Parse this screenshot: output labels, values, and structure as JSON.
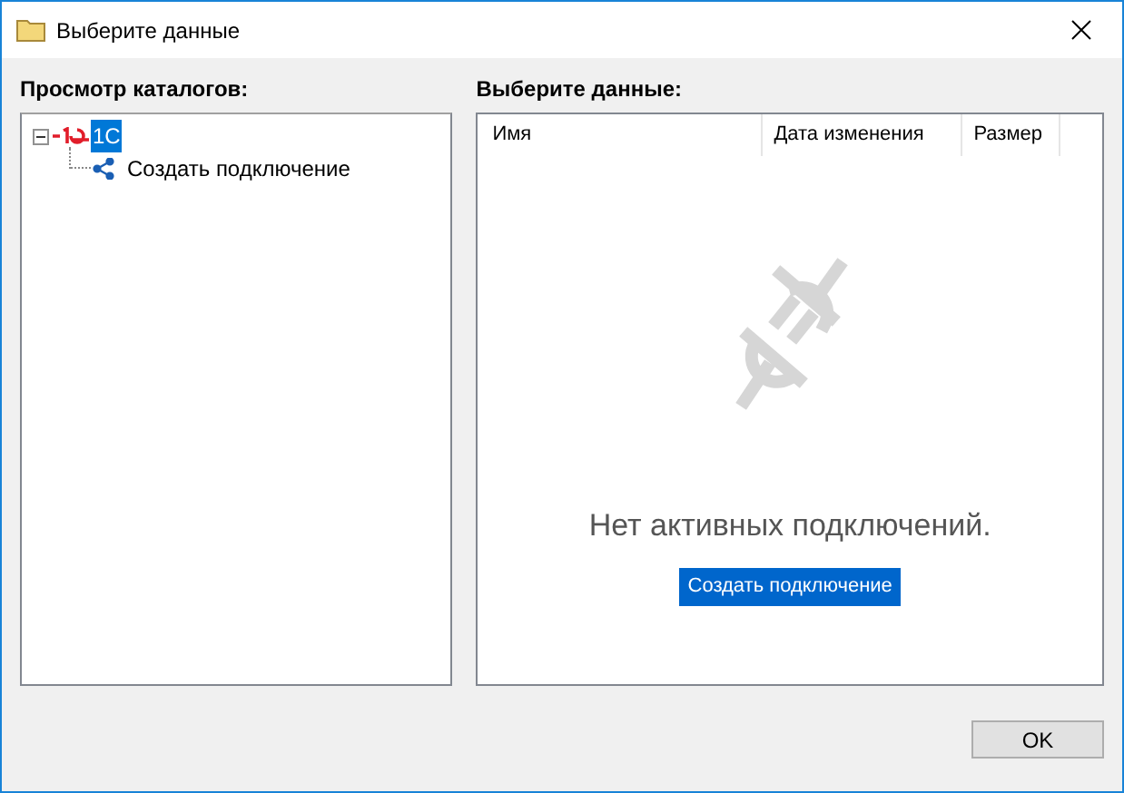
{
  "window": {
    "title": "Выберите данные"
  },
  "catalog_panel": {
    "label": "Просмотр каталогов:",
    "tree": [
      {
        "label": "1С",
        "expanded": true,
        "selected": true,
        "children": [
          {
            "label": "Создать подключение",
            "selected": false
          }
        ]
      }
    ]
  },
  "data_panel": {
    "label": "Выберите данные:",
    "columns": [
      "Имя",
      "Дата изменения",
      "Размер"
    ],
    "empty_message": "Нет активных подключений.",
    "action_button": "Создать подключение"
  },
  "buttons": [
    "OK"
  ]
}
